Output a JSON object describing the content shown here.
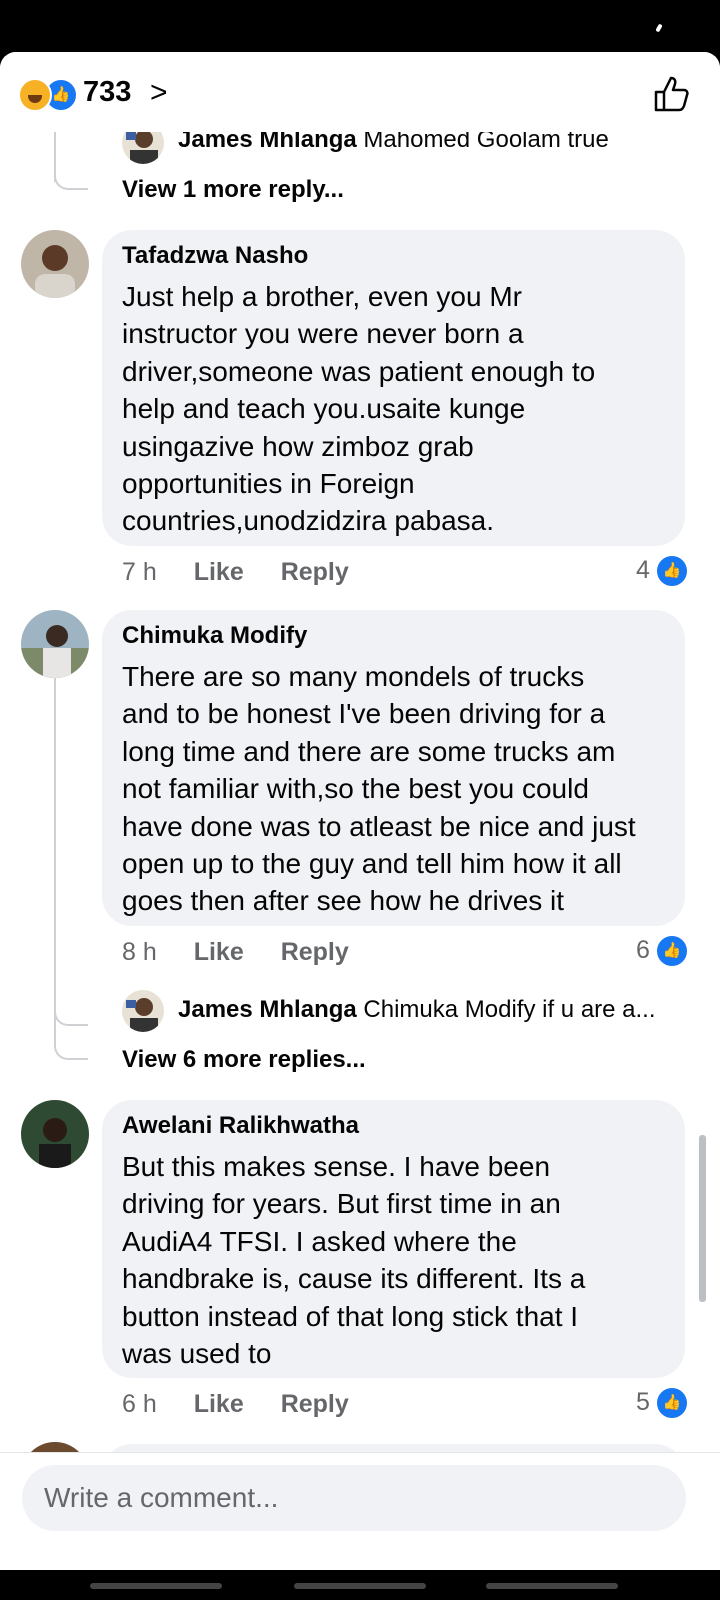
{
  "header": {
    "reaction_count": "733"
  },
  "thread": [
    {
      "type": "reply",
      "author": "James Mhlanga",
      "text": "Mahomed Goolam true"
    },
    {
      "type": "more",
      "label": "View 1 more reply..."
    }
  ],
  "comments": [
    {
      "author": "Tafadzwa Nasho",
      "text": "Just help a brother, even you Mr\ninstructor you were never born a\ndriver,someone was patient enough to\nhelp and teach you.usaite kunge\nusingazive how zimboz grab\nopportunities in Foreign\ncountries,unodzidzira pabasa.",
      "time": "7 h",
      "like_label": "Like",
      "reply_label": "Reply",
      "likes": "4"
    },
    {
      "author": "Chimuka Modify",
      "text": "There are so many mondels of trucks\nand to be honest I've been driving for a\nlong time and there are some trucks am\nnot familiar with,so the best you could\nhave done was to atleast be nice and just\nopen up to the guy and tell him how it all\ngoes then after see how he drives it",
      "time": "8 h",
      "like_label": "Like",
      "reply_label": "Reply",
      "likes": "6",
      "reply": {
        "author": "James Mhlanga",
        "text": "Chimuka Modify if u are a..."
      },
      "more_label": "View 6 more replies..."
    },
    {
      "author": "Awelani Ralikhwatha",
      "text": "But this makes sense. I have been\ndriving for years. But first time in an\nAudiA4 TFSI. I asked where the\nhandbrake is, cause its different. Its a\nbutton instead of that long stick that I\nwas used to",
      "time": "6 h",
      "like_label": "Like",
      "reply_label": "Reply",
      "likes": "5"
    }
  ],
  "composer": {
    "placeholder": "Write a comment..."
  },
  "colors": {
    "accent": "#1877f2",
    "bubble": "#f0f2f5",
    "secondary_text": "#65676b"
  }
}
